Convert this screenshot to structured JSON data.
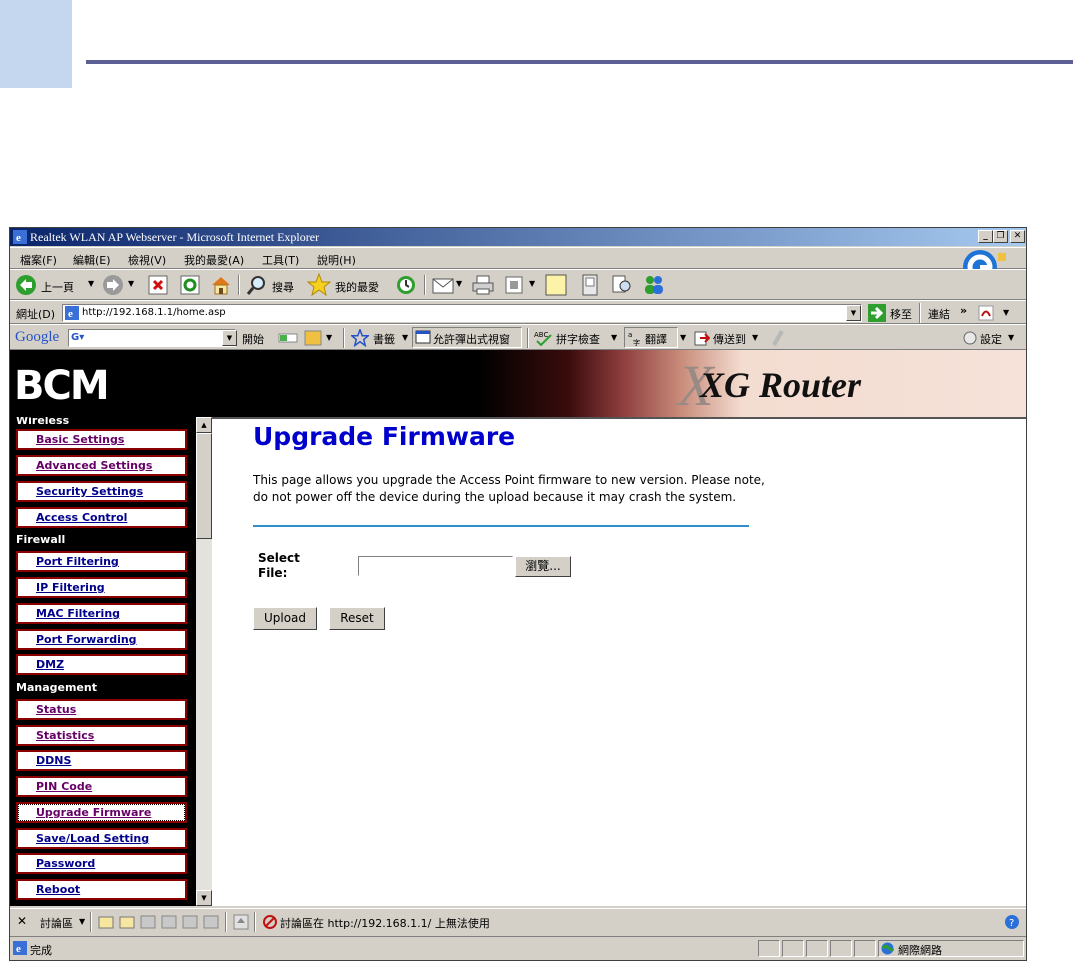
{
  "window": {
    "title": "Realtek WLAN AP Webserver - Microsoft Internet Explorer"
  },
  "menu": [
    "檔案(F)",
    "編輯(E)",
    "檢視(V)",
    "我的最愛(A)",
    "工具(T)",
    "說明(H)"
  ],
  "toolbar": {
    "back": "上一頁",
    "search": "搜尋",
    "favorites": "我的最愛"
  },
  "address": {
    "label": "網址(D)",
    "url": "http://192.168.1.1/home.asp",
    "go": "移至",
    "links": "連結"
  },
  "googlebar": {
    "logo": "Google",
    "start": "開始",
    "bookmarks": "書籤",
    "popup": "允許彈出式視窗",
    "spell": "拼字檢查",
    "translate": "翻譯",
    "sendto": "傳送到",
    "settings": "設定"
  },
  "banner": {
    "logo": "BCM",
    "brand": "XG Router",
    "brand_x": "X"
  },
  "sidebar": {
    "sections": {
      "wireless": "Wireless",
      "firewall": "Firewall",
      "management": "Management"
    },
    "items": [
      "Basic Settings",
      "Advanced Settings",
      "Security Settings",
      "Access Control",
      "Port Filtering",
      "IP Filtering",
      "MAC Filtering",
      "Port Forwarding",
      "DMZ",
      "Status",
      "Statistics",
      "DDNS",
      "PIN Code",
      "Upgrade Firmware",
      "Save/Load Setting",
      "Password",
      "Reboot"
    ]
  },
  "main": {
    "title": "Upgrade Firmware",
    "description": "This page allows you upgrade the Access Point firmware to new version. Please note, do not power off the device during the upload because it may crash the system.",
    "select_label": "Select",
    "file_label": "File:",
    "browse": "瀏覽...",
    "upload": "Upload",
    "reset": "Reset"
  },
  "discuss": {
    "label": "討論區",
    "notice": "討論區在 http://192.168.1.1/ 上無法使用"
  },
  "status": {
    "done": "完成",
    "zone": "網際網路"
  },
  "colors": {
    "title_bar": "#0a246a",
    "link": "#00008b",
    "visited": "#660066",
    "heading": "#0000cc",
    "sidebar_border": "#8b0000"
  }
}
